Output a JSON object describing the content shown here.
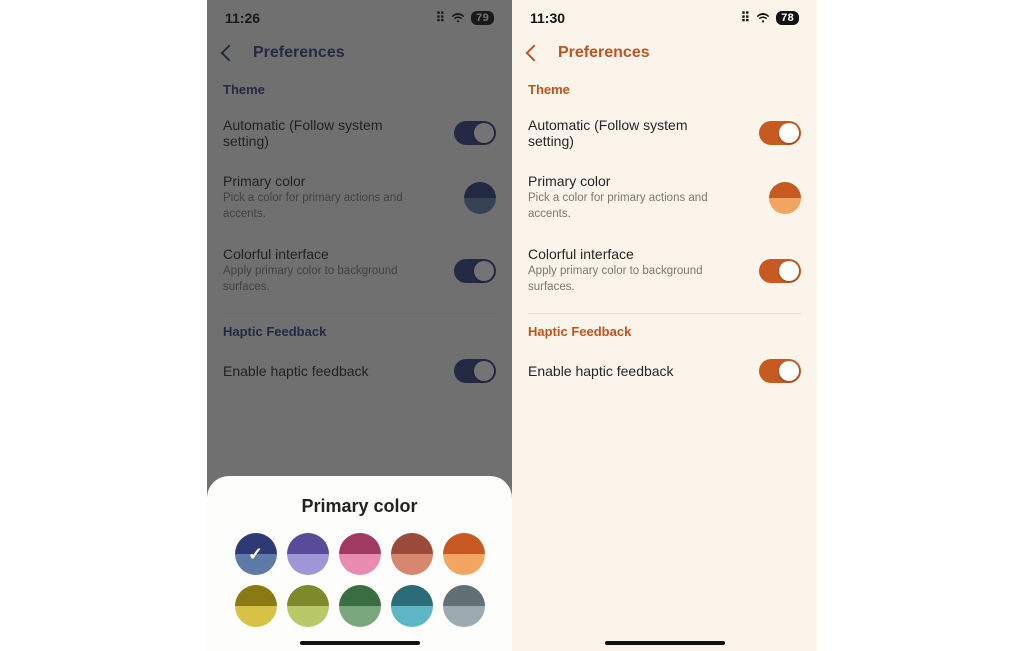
{
  "left": {
    "time": "11:26",
    "battery": "79",
    "navtitle": "Preferences",
    "section_theme": "Theme",
    "row_auto": "Automatic (Follow system setting)",
    "row_primary_title": "Primary color",
    "row_primary_sub": "Pick a color for primary actions and accents.",
    "row_colorful_title": "Colorful interface",
    "row_colorful_sub": "Apply primary color to background surfaces.",
    "section_haptic": "Haptic Feedback",
    "row_haptic": "Enable haptic feedback",
    "swatch_top": "#2d3a73",
    "swatch_bot": "#5d7ba6"
  },
  "right": {
    "time": "11:30",
    "battery": "78",
    "navtitle": "Preferences",
    "section_theme": "Theme",
    "row_auto": "Automatic (Follow system setting)",
    "row_primary_title": "Primary color",
    "row_primary_sub": "Pick a color for primary actions and accents.",
    "row_colorful_title": "Colorful interface",
    "row_colorful_sub": "Apply primary color to background surfaces.",
    "section_haptic": "Haptic Feedback",
    "row_haptic": "Enable haptic feedback",
    "swatch_top": "#c65a21",
    "swatch_bot": "#f2a560"
  },
  "sheet": {
    "title": "Primary color",
    "colors": [
      {
        "top": "#2d3a73",
        "bot": "#5d7ba6",
        "selected": true
      },
      {
        "top": "#5a4a9a",
        "bot": "#9e96d6",
        "selected": false
      },
      {
        "top": "#a13a62",
        "bot": "#e98bb1",
        "selected": false
      },
      {
        "top": "#9a4a3a",
        "bot": "#d7866f",
        "selected": false
      },
      {
        "top": "#c65a21",
        "bot": "#f2a560",
        "selected": false
      },
      {
        "top": "#8a7a14",
        "bot": "#d8c246",
        "selected": false
      },
      {
        "top": "#7d8a2c",
        "bot": "#b9c96a",
        "selected": false
      },
      {
        "top": "#3a6d3f",
        "bot": "#78a77c",
        "selected": false
      },
      {
        "top": "#2a6d78",
        "bot": "#5fb6c4",
        "selected": false
      },
      {
        "top": "#607075",
        "bot": "#9aaab0",
        "selected": false
      }
    ]
  }
}
